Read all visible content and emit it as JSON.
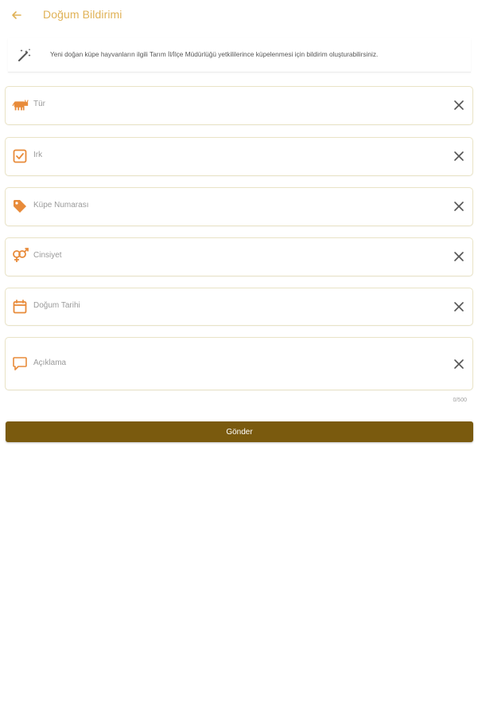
{
  "header": {
    "title": "Doğum Bildirimi",
    "back_icon": "arrow-left-icon",
    "accent": "#e0b257"
  },
  "info": {
    "icon": "magic-wand-icon",
    "text": "Yeni doğan küpe hayvanların ilgili Tarım İl/İlçe Müdürlüğü yetkililerince küpelenmesi için bildirim oluşturabilirsiniz."
  },
  "fields": [
    {
      "label": "Tür",
      "icon": "cow-icon"
    },
    {
      "label": "Irk",
      "icon": "checkbox-icon"
    },
    {
      "label": "Küpe Numarası",
      "icon": "tag-icon"
    },
    {
      "label": "Cinsiyet",
      "icon": "gender-icon"
    },
    {
      "label": "Doğum Tarihi",
      "icon": "calendar-icon"
    },
    {
      "label": "Açıklama",
      "icon": "comment-icon"
    }
  ],
  "counter": "0/500",
  "submit": {
    "label": "Gönder",
    "color": "#7a5a0e"
  },
  "colors": {
    "icon": "#e88b3a",
    "field_border": "#e9e3c6"
  }
}
